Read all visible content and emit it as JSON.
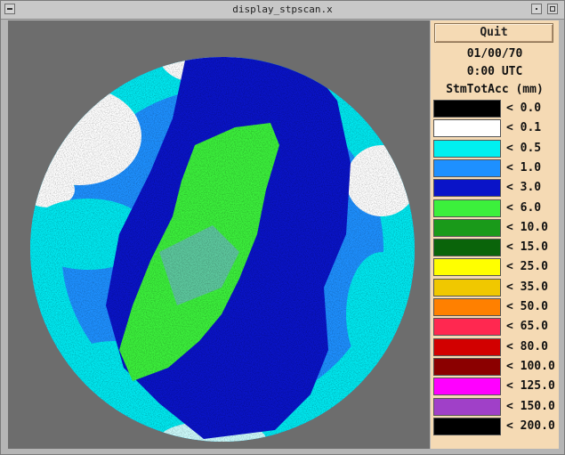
{
  "window": {
    "title": "display_stpscan.x"
  },
  "panel": {
    "quit_label": "Quit",
    "date": "01/00/70",
    "time": "0:00 UTC",
    "field_label": "StmTotAcc (mm)"
  },
  "legend": [
    {
      "label": "< 0.0",
      "color": "#000000"
    },
    {
      "label": "< 0.1",
      "color": "#ffffff"
    },
    {
      "label": "< 0.5",
      "color": "#00f0f0"
    },
    {
      "label": "< 1.0",
      "color": "#1e90ff"
    },
    {
      "label": "< 3.0",
      "color": "#0a14c8"
    },
    {
      "label": "< 6.0",
      "color": "#3cf03c"
    },
    {
      "label": "< 10.0",
      "color": "#1a9a1a"
    },
    {
      "label": "< 15.0",
      "color": "#0a640a"
    },
    {
      "label": "< 25.0",
      "color": "#ffff00"
    },
    {
      "label": "< 35.0",
      "color": "#f0c800"
    },
    {
      "label": "< 50.0",
      "color": "#ff8000"
    },
    {
      "label": "< 65.0",
      "color": "#ff2850"
    },
    {
      "label": "< 80.0",
      "color": "#d20000"
    },
    {
      "label": "< 100.0",
      "color": "#8b0000"
    },
    {
      "label": "< 125.0",
      "color": "#ff00ff"
    },
    {
      "label": "< 150.0",
      "color": "#a040c8"
    },
    {
      "label": "< 200.0",
      "color": "#000000"
    }
  ]
}
